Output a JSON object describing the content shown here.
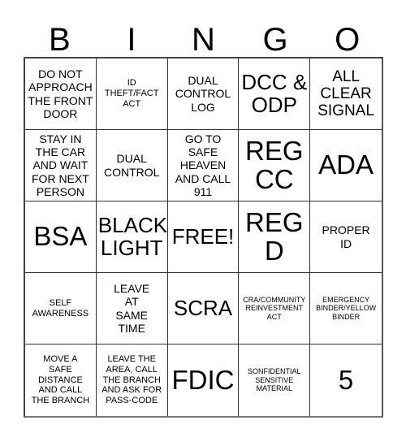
{
  "card": {
    "title": "BINGO Card",
    "header_letters": [
      "B",
      "I",
      "N",
      "G",
      "O"
    ],
    "grid_size": "5x5",
    "free_space_label": "FREE!",
    "colors": {
      "background": "#ffffff",
      "text": "#000000",
      "grid_line": "#333333",
      "outer_border": "#444444"
    },
    "rows": [
      [
        {
          "text": "DO NOT\nAPPROACH\nTHE FRONT\nDOOR",
          "size": "m"
        },
        {
          "text": "ID\nTHEFT/FACT\nACT",
          "size": "s"
        },
        {
          "text": "DUAL\nCONTROL\nLOG",
          "size": "m"
        },
        {
          "text": "DCC &\nODP",
          "size": "xl"
        },
        {
          "text": "ALL\nCLEAR\nSIGNAL",
          "size": "l"
        }
      ],
      [
        {
          "text": "STAY IN\nTHE CAR\nAND WAIT\nFOR NEXT\nPERSON",
          "size": "m"
        },
        {
          "text": "DUAL\nCONTROL",
          "size": "m"
        },
        {
          "text": "GO TO\nSAFE\nHEAVEN\nAND CALL\n911",
          "size": "m"
        },
        {
          "text": "REG\nCC",
          "size": "xxl"
        },
        {
          "text": "ADA",
          "size": "xxl"
        }
      ],
      [
        {
          "text": "BSA",
          "size": "xxl"
        },
        {
          "text": "BLACK\nLIGHT",
          "size": "xl"
        },
        {
          "text": "FREE!",
          "size": "xl"
        },
        {
          "text": "REG\nD",
          "size": "xxl"
        },
        {
          "text": "PROPER\nID",
          "size": "m"
        }
      ],
      [
        {
          "text": "SELF\nAWARENESS",
          "size": "s"
        },
        {
          "text": "LEAVE\nAT\nSAME\nTIME",
          "size": "m"
        },
        {
          "text": "SCRA",
          "size": "xl"
        },
        {
          "text": "CRA/COMMUNITY\nREINVESTMENT\nACT",
          "size": "xs"
        },
        {
          "text": "EMERGENCY\nBINDER/YELLOW\nBINDER",
          "size": "xs"
        }
      ],
      [
        {
          "text": "MOVE A\nSAFE\nDISTANCE\nAND CALL\nTHE BRANCH",
          "size": "s"
        },
        {
          "text": "LEAVE THE\nAREA, CALL\nTHE BRANCH\nAND ASK FOR\nPASS-CODE",
          "size": "s"
        },
        {
          "text": "FDIC",
          "size": "xxl"
        },
        {
          "text": "SONFIDENTIAL\nSENSITIVE\nMATERIAL",
          "size": "xs"
        },
        {
          "text": "5",
          "size": "xxl"
        }
      ]
    ]
  }
}
